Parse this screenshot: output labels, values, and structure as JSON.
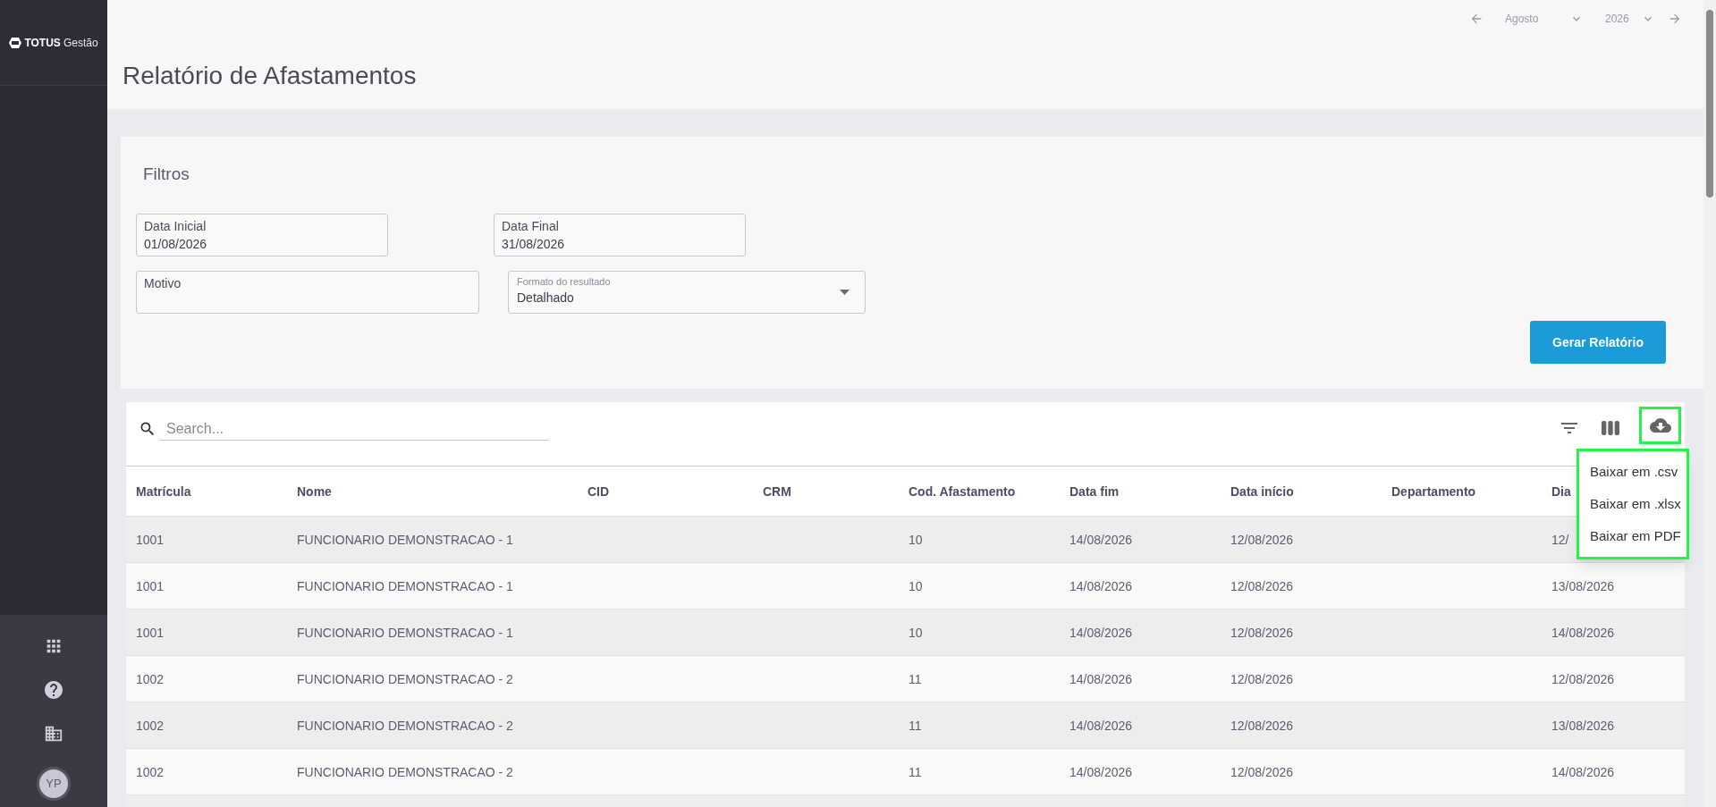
{
  "sidebar": {
    "logo": {
      "brand": "TOTUS",
      "product": "Gestão"
    },
    "avatar": "YP"
  },
  "period": {
    "month": "Agosto",
    "year": "2026"
  },
  "title": "Relatório de Afastamentos",
  "filters": {
    "title": "Filtros",
    "fields": [
      {
        "kind": "text",
        "label": "Data Inicial",
        "value": "01/08/2026"
      },
      {
        "kind": "text",
        "label": "Data Final",
        "value": "31/08/2026"
      },
      {
        "kind": "text",
        "label": "Motivo"
      },
      {
        "kind": "select",
        "label": "Formato do resultado",
        "value": "Detalhado"
      }
    ],
    "button": "Gerar Relatório"
  },
  "table": {
    "search": {
      "placeholder": "Search..."
    },
    "download": {
      "highlighted": true,
      "menu": {
        "highlighted": true,
        "items": [
          "Baixar em .csv",
          "Baixar em .xlsx",
          "Baixar em PDF"
        ]
      }
    },
    "columns": [
      "Matrícula",
      "Nome",
      "CID",
      "CRM",
      "Cod. Afastamento",
      "Data fim",
      "Data início",
      "Departamento",
      "Dia"
    ],
    "rows": [
      [
        "1001",
        "FUNCIONARIO DEMONSTRACAO - 1",
        null,
        null,
        "10",
        "14/08/2026",
        "12/08/2026",
        null,
        "12/"
      ],
      [
        "1001",
        "FUNCIONARIO DEMONSTRACAO - 1",
        null,
        null,
        "10",
        "14/08/2026",
        "12/08/2026",
        null,
        "13/08/2026"
      ],
      [
        "1001",
        "FUNCIONARIO DEMONSTRACAO - 1",
        null,
        null,
        "10",
        "14/08/2026",
        "12/08/2026",
        null,
        "14/08/2026"
      ],
      [
        "1002",
        "FUNCIONARIO DEMONSTRACAO - 2",
        null,
        null,
        "11",
        "14/08/2026",
        "12/08/2026",
        null,
        "12/08/2026"
      ],
      [
        "1002",
        "FUNCIONARIO DEMONSTRACAO - 2",
        null,
        null,
        "11",
        "14/08/2026",
        "12/08/2026",
        null,
        "13/08/2026"
      ],
      [
        "1002",
        "FUNCIONARIO DEMONSTRACAO - 2",
        null,
        null,
        "11",
        "14/08/2026",
        "12/08/2026",
        null,
        "14/08/2026"
      ]
    ]
  }
}
